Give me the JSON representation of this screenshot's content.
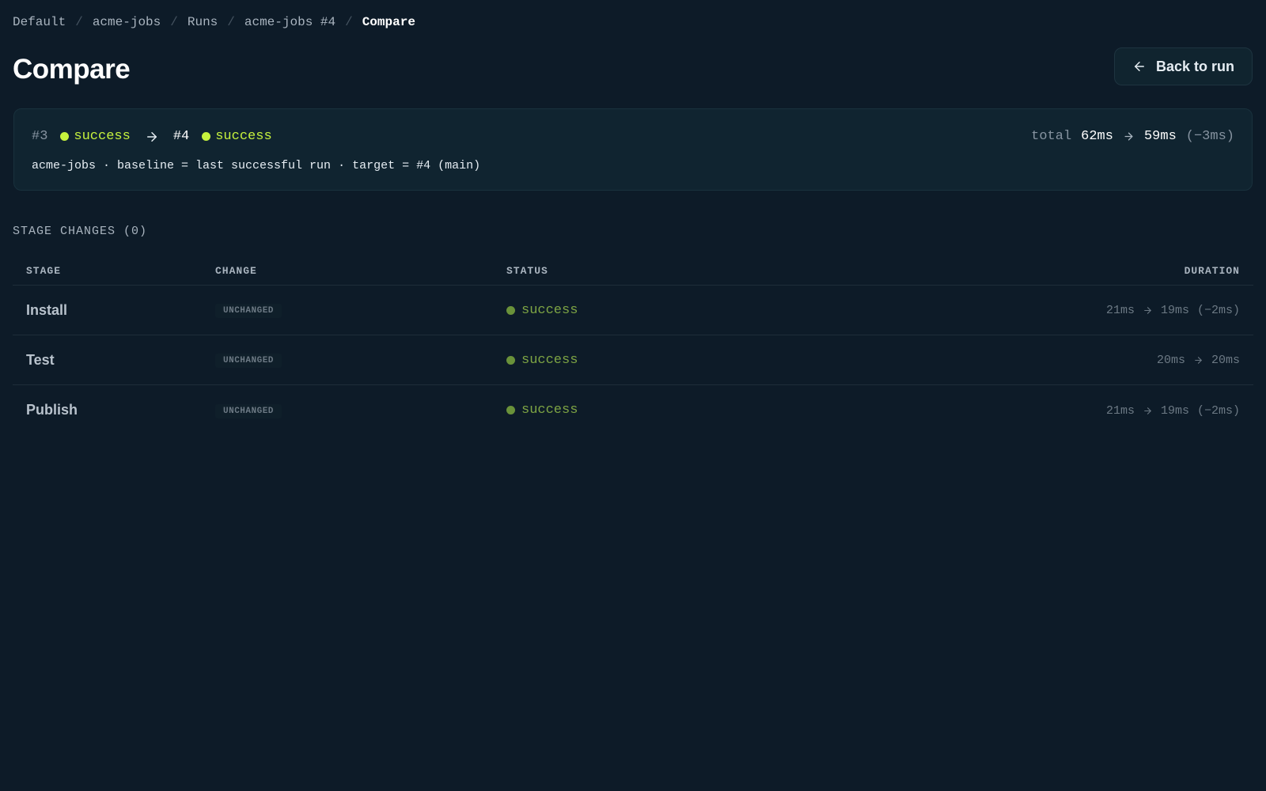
{
  "breadcrumb": [
    {
      "label": "Default"
    },
    {
      "label": "acme-jobs"
    },
    {
      "label": "Runs"
    },
    {
      "label": "acme-jobs #4"
    },
    {
      "label": "Compare"
    }
  ],
  "header": {
    "title": "Compare",
    "back_label": "Back to run"
  },
  "summary": {
    "base_run": "#3",
    "base_status": "success",
    "target_run": "#4",
    "target_status": "success",
    "total_label": "total",
    "total_before": "62ms",
    "total_after": "59ms",
    "total_delta": "(−3ms)",
    "meta": "acme-jobs · baseline = last successful run · target = #4 (main)"
  },
  "stage_changes": {
    "label": "STAGE CHANGES (0)",
    "columns": {
      "stage": "STAGE",
      "change": "CHANGE",
      "status": "STATUS",
      "duration": "DURATION"
    },
    "rows": [
      {
        "stage": "Install",
        "change": "UNCHANGED",
        "status": "success",
        "before": "21ms",
        "after": "19ms",
        "delta": "(−2ms)"
      },
      {
        "stage": "Test",
        "change": "UNCHANGED",
        "status": "success",
        "before": "20ms",
        "after": "20ms",
        "delta": ""
      },
      {
        "stage": "Publish",
        "change": "UNCHANGED",
        "status": "success",
        "before": "21ms",
        "after": "19ms",
        "delta": "(−2ms)"
      }
    ]
  },
  "colors": {
    "background": "#0d1b28",
    "accent_success": "#c6f23d",
    "row_success": "#7ea544"
  },
  "icons": {
    "back": "arrow-left-icon",
    "compare_arrow": "arrow-right-icon"
  }
}
